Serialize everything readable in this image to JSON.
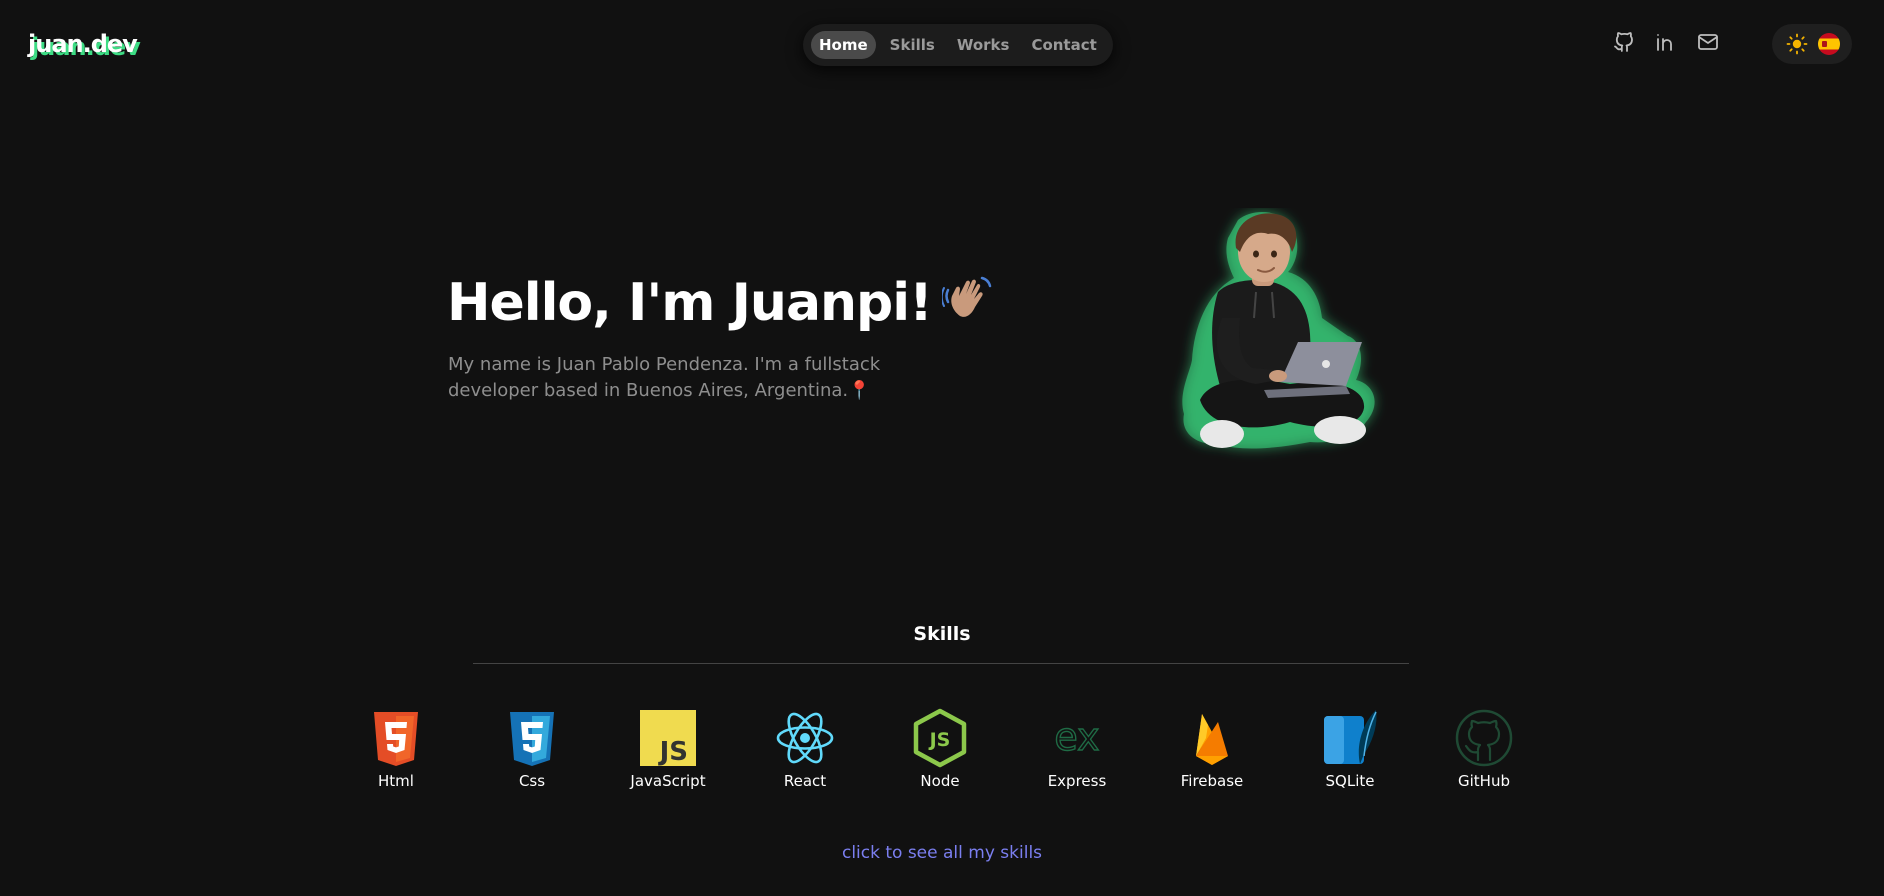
{
  "header": {
    "logo": "juan.dev",
    "nav": [
      {
        "label": "Home",
        "active": true
      },
      {
        "label": "Skills",
        "active": false
      },
      {
        "label": "Works",
        "active": false
      },
      {
        "label": "Contact",
        "active": false
      }
    ],
    "icons": [
      "github-icon",
      "linkedin-icon",
      "mail-icon",
      "sun-icon",
      "spain-flag-icon"
    ]
  },
  "hero": {
    "title": "Hello, I'm Juanpi!",
    "wave_icon": "waving-hand-icon",
    "subtitle": "My name is Juan Pablo Pendenza. I'm a fullstack developer based in Buenos Aires, Argentina.",
    "pin_icon": "round-pushpin-icon"
  },
  "skills": {
    "title": "Skills",
    "items": [
      {
        "label": "Html",
        "icon": "html5-icon"
      },
      {
        "label": "Css",
        "icon": "css3-icon"
      },
      {
        "label": "JavaScript",
        "icon": "javascript-icon"
      },
      {
        "label": "React",
        "icon": "react-icon"
      },
      {
        "label": "Node",
        "icon": "nodejs-icon"
      },
      {
        "label": "Express",
        "icon": "express-icon"
      },
      {
        "label": "Firebase",
        "icon": "firebase-icon"
      },
      {
        "label": "SQLite",
        "icon": "sqlite-icon"
      },
      {
        "label": "GitHub",
        "icon": "github-icon"
      }
    ],
    "see_all": "click to see all my skills"
  },
  "colors": {
    "background": "#111111",
    "accent_green": "#3ddc84",
    "link": "#7b7ff0",
    "muted": "#8e8e8e"
  }
}
